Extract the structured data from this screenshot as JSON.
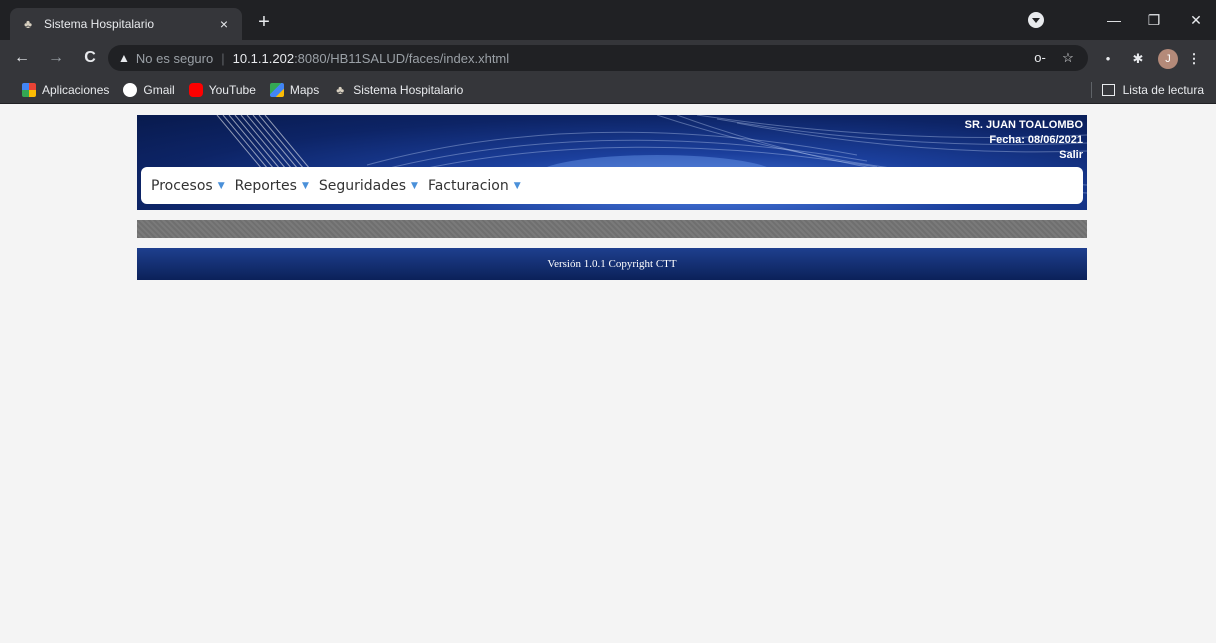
{
  "browser": {
    "tab": {
      "title": "Sistema Hospitalario",
      "close": "×"
    },
    "new_tab": "+",
    "window_controls": {
      "minimize": "—",
      "restore": "❐",
      "close": "✕"
    },
    "nav": {
      "back": "←",
      "forward": "→",
      "reload": "C"
    },
    "address": {
      "security_icon": "▲",
      "security_label": "No es seguro",
      "host": "10.1.1.202",
      "rest": ":8080/HB11SALUD/faces/index.xhtml"
    },
    "omnibox_icons": {
      "key": "o-",
      "star": "☆"
    },
    "extensions": {
      "ext1": "•",
      "puzzle": "✱",
      "menu": "⋮"
    },
    "avatar_letter": "J",
    "bookmarks": [
      {
        "label": "Aplicaciones",
        "icon": "apps-icon"
      },
      {
        "label": "Gmail",
        "icon": "gmail-icon"
      },
      {
        "label": "YouTube",
        "icon": "youtube-icon"
      },
      {
        "label": "Maps",
        "icon": "maps-icon"
      },
      {
        "label": "Sistema Hospitalario",
        "icon": "hospital-icon"
      }
    ],
    "reading_list": "Lista de lectura"
  },
  "header": {
    "user": "SR. JUAN TOALOMBO",
    "date": "Fecha: 08/06/2021",
    "logout": "Salir"
  },
  "menu": [
    {
      "label": "Procesos",
      "caret": "▼"
    },
    {
      "label": "Reportes",
      "caret": "▼"
    },
    {
      "label": "Seguridades",
      "caret": "▼"
    },
    {
      "label": "Facturacion",
      "caret": "▼"
    }
  ],
  "footer": {
    "text": "Versión 1.0.1 Copyright CTT"
  }
}
